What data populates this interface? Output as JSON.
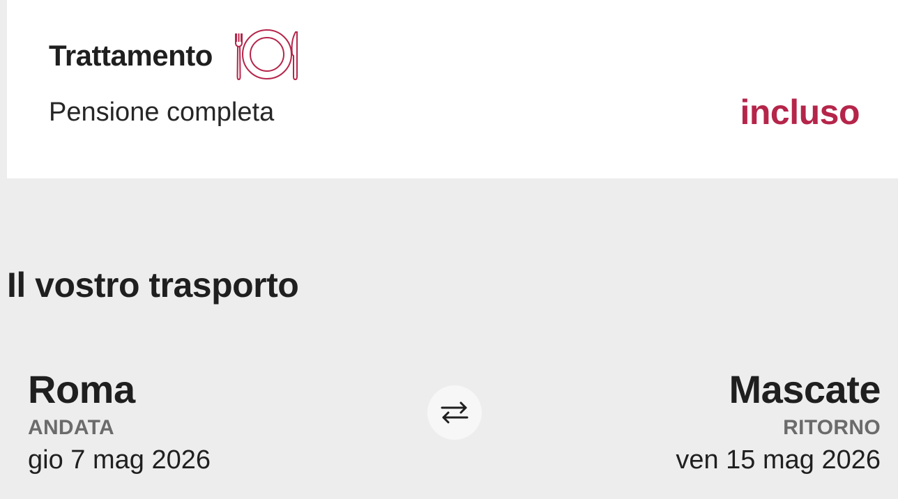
{
  "board": {
    "title": "Trattamento",
    "icon": "plate-cutlery-icon",
    "value": "Pensione completa",
    "status": "incluso"
  },
  "transport": {
    "title": "Il vostro trasporto",
    "outbound": {
      "city": "Roma",
      "label": "ANDATA",
      "date": "gio 7 mag 2026"
    },
    "return": {
      "city": "Mascate",
      "label": "RITORNO",
      "date": "ven 15 mag 2026"
    },
    "swap_icon": "swap-arrows-icon"
  },
  "colors": {
    "accent": "#b5254a",
    "text": "#1f1f1f",
    "muted": "#6b6b6b",
    "background": "#ededed",
    "card": "#ffffff"
  }
}
